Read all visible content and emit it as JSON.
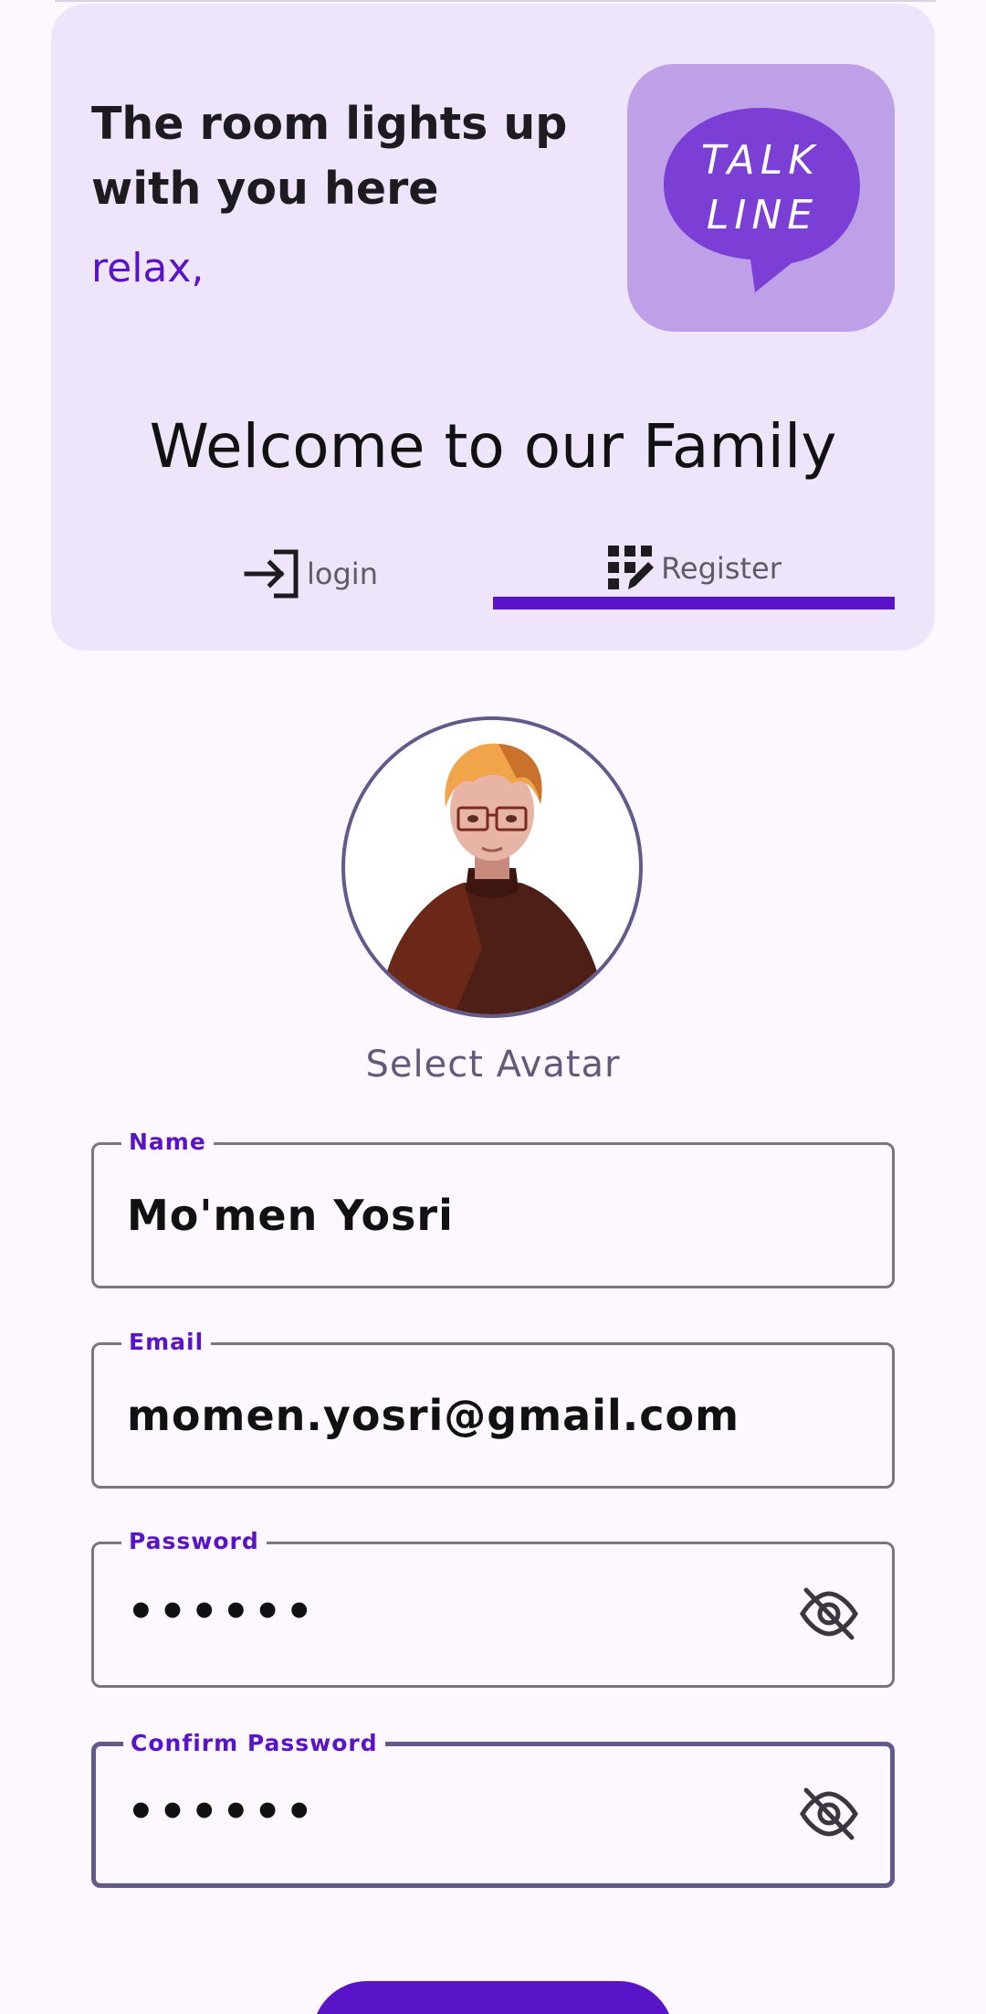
{
  "header": {
    "tagline": "The room lights up with you here",
    "subtag": "relax,",
    "logo_line1": "TALK",
    "logo_line2": "LINE",
    "welcome": "Welcome to our Family"
  },
  "tabs": [
    {
      "label": "login",
      "icon": "login-icon",
      "selected": false
    },
    {
      "label": "Register",
      "icon": "register-icon",
      "selected": true
    }
  ],
  "avatar": {
    "caption": "Select Avatar"
  },
  "form": {
    "name": {
      "label": "Name",
      "value": "Mo'men Yosri"
    },
    "email": {
      "label": "Email",
      "value": "momen.yosri@gmail.com"
    },
    "password": {
      "label": "Password",
      "value": "••••••",
      "icon": "visibility-off-icon"
    },
    "confirm_password": {
      "label": "Confirm Password",
      "value": "••••••",
      "icon": "visibility-off-icon"
    }
  },
  "colors": {
    "accent": "#5a14c8",
    "card": "#efe5fb",
    "background": "#fdf7ff"
  }
}
